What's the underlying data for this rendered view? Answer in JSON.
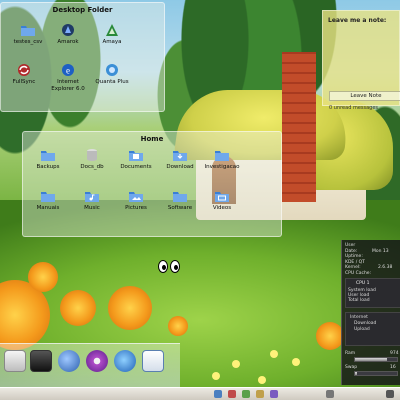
{
  "desktop_folder": {
    "title": "Desktop Folder",
    "items": [
      {
        "label": "testes_csv",
        "icon": "folder-icon"
      },
      {
        "label": "Amarok",
        "icon": "amarok-icon"
      },
      {
        "label": "Amaya",
        "icon": "amaya-icon"
      },
      {
        "label": "FullSync",
        "icon": "fullsync-icon"
      },
      {
        "label": "Internet Explorer 6.0",
        "icon": "ie-icon"
      },
      {
        "label": "Quanta Plus",
        "icon": "quanta-icon"
      }
    ]
  },
  "home_folder": {
    "title": "Home",
    "items": [
      {
        "label": "Backups",
        "icon": "folder-icon"
      },
      {
        "label": "Docs_db",
        "icon": "database-folder-icon"
      },
      {
        "label": "Documents",
        "icon": "documents-folder-icon"
      },
      {
        "label": "Download",
        "icon": "download-folder-icon"
      },
      {
        "label": "Investigacao",
        "icon": "folder-icon"
      },
      {
        "label": "Manuais",
        "icon": "folder-icon"
      },
      {
        "label": "Music",
        "icon": "music-folder-icon"
      },
      {
        "label": "Pictures",
        "icon": "pictures-folder-icon"
      },
      {
        "label": "Software",
        "icon": "folder-icon"
      },
      {
        "label": "Videos",
        "icon": "videos-folder-icon"
      }
    ]
  },
  "note": {
    "title": "Leave me a note:",
    "button": "Leave Note",
    "messages": "0 unread messages"
  },
  "sysmon": {
    "user_label": "User",
    "date_label": "Date:",
    "date_value": "Mon 13",
    "uptime_label": "Uptime:",
    "kde_label": "KDE / QT",
    "kernel_label": "Kernel:",
    "kernel_value": "2.6.38",
    "cpu_cache_label": "CPU Cache:",
    "cpu_label": "CPU 1",
    "system_load_label": "System load",
    "user_load_label": "User load",
    "total_load_label": "Total load",
    "internet_label": "Internet",
    "download_label": "Download",
    "upload_label": "Upload",
    "ram_label": "Ram",
    "ram_value": "974",
    "swap_label": "Swap",
    "swap_value": "16",
    "ram_fraction": 0.75,
    "swap_fraction": 0.05
  },
  "dock": {
    "items": [
      "windows-icon",
      "terminal-icon",
      "thunderbird-icon",
      "media-player-icon",
      "browser-icon",
      "text-editor-icon"
    ]
  },
  "colors": {
    "folder_blue": "#3a7fd5",
    "note_yellow": "#e8e282",
    "monitor_bg": "#141418"
  }
}
